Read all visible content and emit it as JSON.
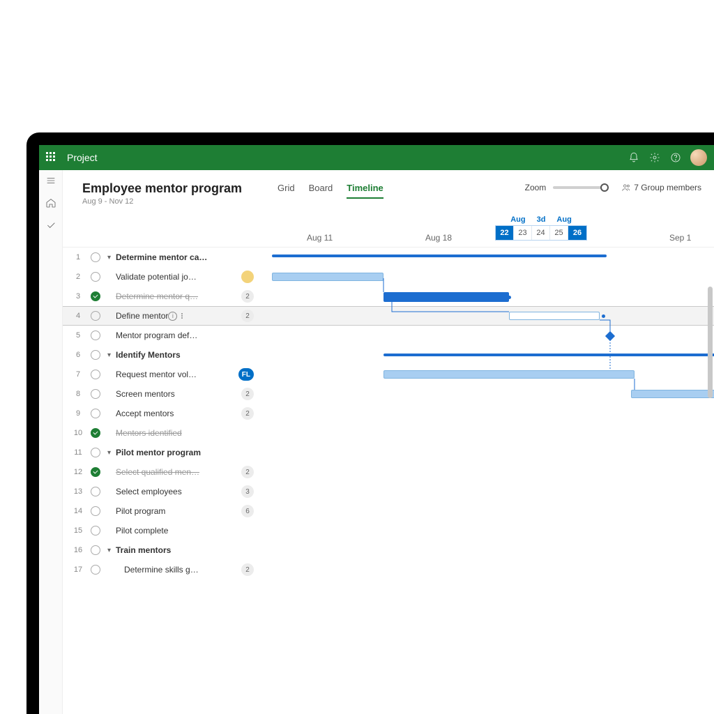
{
  "app": {
    "name": "Project"
  },
  "page": {
    "title": "Employee mentor program",
    "date_range": "Aug 9 - Nov 12"
  },
  "tabs": {
    "grid": "Grid",
    "board": "Board",
    "timeline": "Timeline"
  },
  "zoom": {
    "label": "Zoom"
  },
  "members": {
    "label": "7 Group members"
  },
  "axis": {
    "aug11": "Aug 11",
    "aug18": "Aug 18",
    "sep1": "Sep 1"
  },
  "selector": {
    "left_label": "Aug",
    "mid_label": "3d",
    "right_label": "Aug",
    "d22": "22",
    "d23": "23",
    "d24": "24",
    "d25": "25",
    "d26": "26"
  },
  "tasks": [
    {
      "num": "1",
      "name": "Determine mentor ca…",
      "bold": true,
      "caret": true
    },
    {
      "num": "2",
      "name": "Validate potential jo…",
      "indent": 1,
      "assignee": true
    },
    {
      "num": "3",
      "name": "Determine mentor q…",
      "indent": 1,
      "done": true,
      "strike": true,
      "badge": "2"
    },
    {
      "num": "4",
      "name": "Define mentor",
      "indent": 1,
      "selected": true,
      "info": true,
      "more": true,
      "badge": "2"
    },
    {
      "num": "5",
      "name": "Mentor program def…",
      "indent": 1
    },
    {
      "num": "6",
      "name": "Identify Mentors",
      "bold": true,
      "caret": true
    },
    {
      "num": "7",
      "name": "Request mentor vol…",
      "indent": 1,
      "badge": "FL",
      "badgeBlue": true
    },
    {
      "num": "8",
      "name": "Screen mentors",
      "indent": 1,
      "badge": "2"
    },
    {
      "num": "9",
      "name": "Accept mentors",
      "indent": 1,
      "badge": "2"
    },
    {
      "num": "10",
      "name": "Mentors identified",
      "indent": 1,
      "done": true,
      "strike": true
    },
    {
      "num": "11",
      "name": "Pilot mentor program",
      "bold": true,
      "caret": true
    },
    {
      "num": "12",
      "name": "Select qualified men…",
      "indent": 1,
      "done": true,
      "strike": true,
      "badge": "2"
    },
    {
      "num": "13",
      "name": "Select employees",
      "indent": 1,
      "badge": "3"
    },
    {
      "num": "14",
      "name": "Pilot program",
      "indent": 1,
      "badge": "6"
    },
    {
      "num": "15",
      "name": "Pilot complete",
      "indent": 1
    },
    {
      "num": "16",
      "name": "Train mentors",
      "bold": true,
      "caret": true
    },
    {
      "num": "17",
      "name": "Determine skills g…",
      "indent": 2,
      "badge": "2"
    }
  ]
}
